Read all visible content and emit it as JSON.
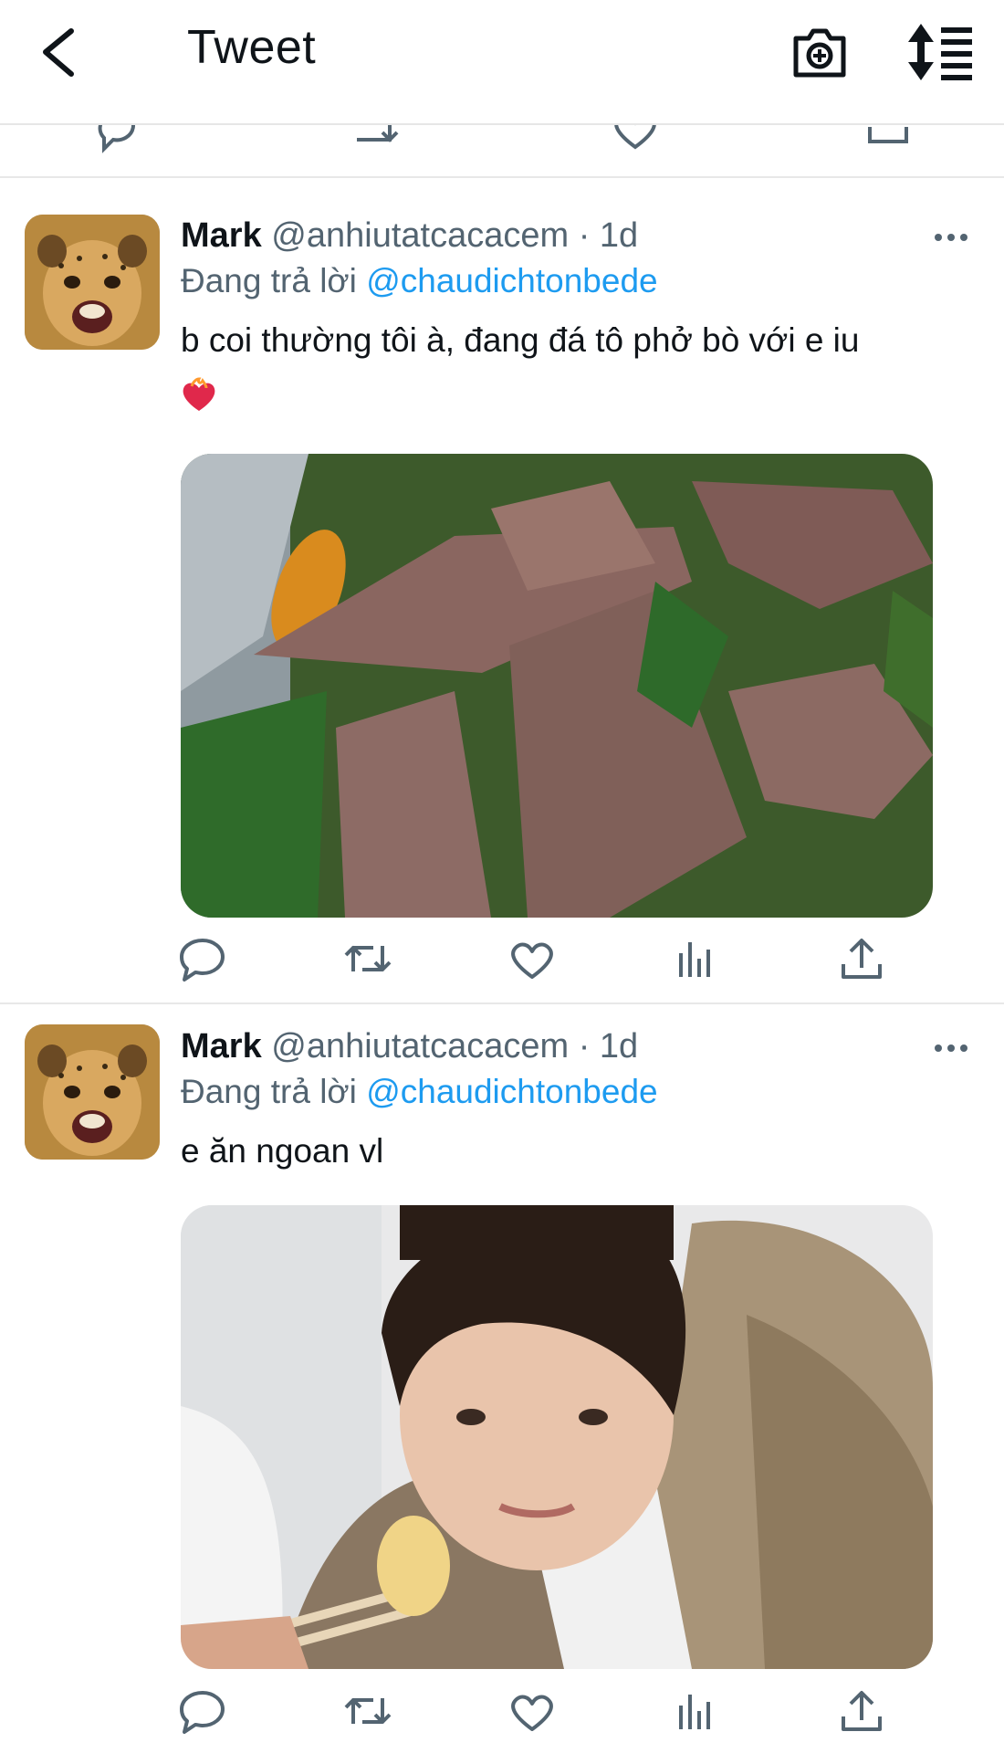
{
  "header": {
    "title": "Tweet",
    "back_icon": "chevron-left-icon",
    "camera_icon": "camera-add-icon",
    "sort_icon": "sort-list-icon"
  },
  "tweets": [
    {
      "name": "Mark",
      "handle": "@anhiutatcacacem",
      "separator": "·",
      "time": "1d",
      "reply_prefix": "Đang trả lời",
      "reply_to": "@chaudichtonbede",
      "text": "b coi thường tôi à, đang đá tô phở bò với e iu",
      "emoji": "heart-on-fire-emoji",
      "media": "photo of beef pho close-up"
    },
    {
      "name": "Mark",
      "handle": "@anhiutatcacacem",
      "separator": "·",
      "time": "1d",
      "reply_prefix": "Đang trả lời",
      "reply_to": "@chaudichtonbede",
      "text": "e ăn ngoan vl",
      "media": "photo of young man eating with chopsticks"
    }
  ],
  "colors": {
    "accent": "#1d9bf0",
    "secondary_text": "#536471",
    "icon": "#536471",
    "divider": "#e8e8e8"
  }
}
